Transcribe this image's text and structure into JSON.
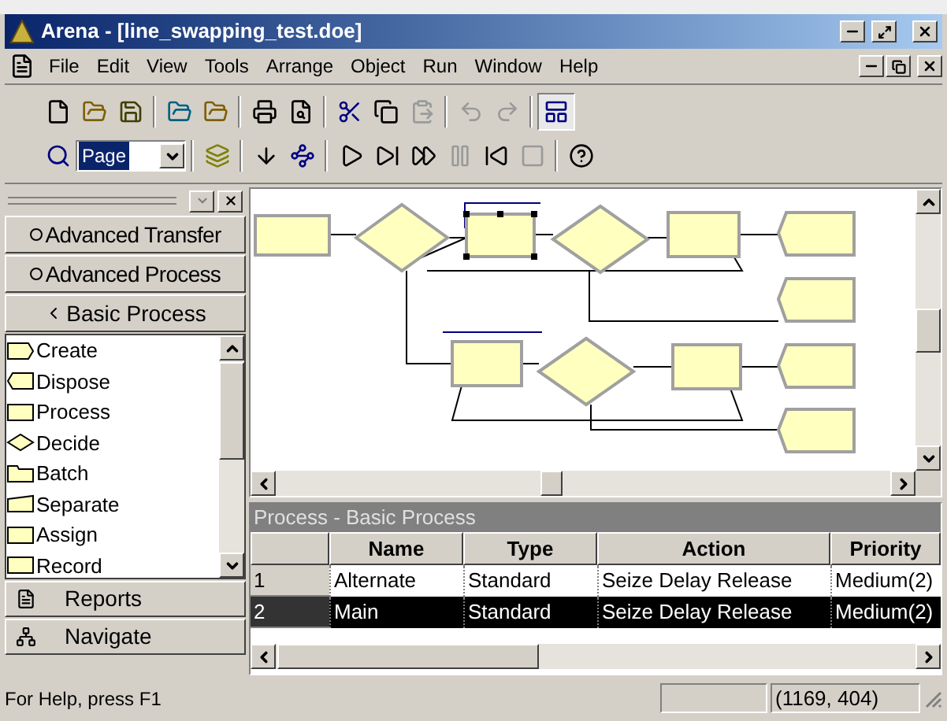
{
  "window": {
    "title": "Arena - [line_swapping_test.doe]"
  },
  "menu": [
    "File",
    "Edit",
    "View",
    "Tools",
    "Arrange",
    "Object",
    "Run",
    "Window",
    "Help"
  ],
  "zoom_field": {
    "value": "Page"
  },
  "panel": {
    "bars": [
      {
        "label": "Advanced Transfer",
        "expanded": false
      },
      {
        "label": "Advanced Process",
        "expanded": false
      },
      {
        "label": "Basic Process",
        "expanded": true
      }
    ],
    "modules": [
      {
        "label": "Create"
      },
      {
        "label": "Dispose"
      },
      {
        "label": "Process"
      },
      {
        "label": "Decide"
      },
      {
        "label": "Batch"
      },
      {
        "label": "Separate"
      },
      {
        "label": "Assign"
      },
      {
        "label": "Record"
      }
    ],
    "bottom_bars": [
      "Reports",
      "Navigate"
    ]
  },
  "grid": {
    "title": "Process - Basic Process",
    "columns": [
      "Name",
      "Type",
      "Action",
      "Priority"
    ],
    "rows": [
      {
        "number": "1",
        "cells": [
          "Alternate",
          "Standard",
          "Seize Delay Release",
          "Medium(2)"
        ],
        "selected": false
      },
      {
        "number": "2",
        "cells": [
          "Main",
          "Standard",
          "Seize Delay Release",
          "Medium(2)"
        ],
        "selected": true
      }
    ]
  },
  "status_bar": {
    "help": "For Help, press F1",
    "coordinates": "(1169, 404)"
  }
}
